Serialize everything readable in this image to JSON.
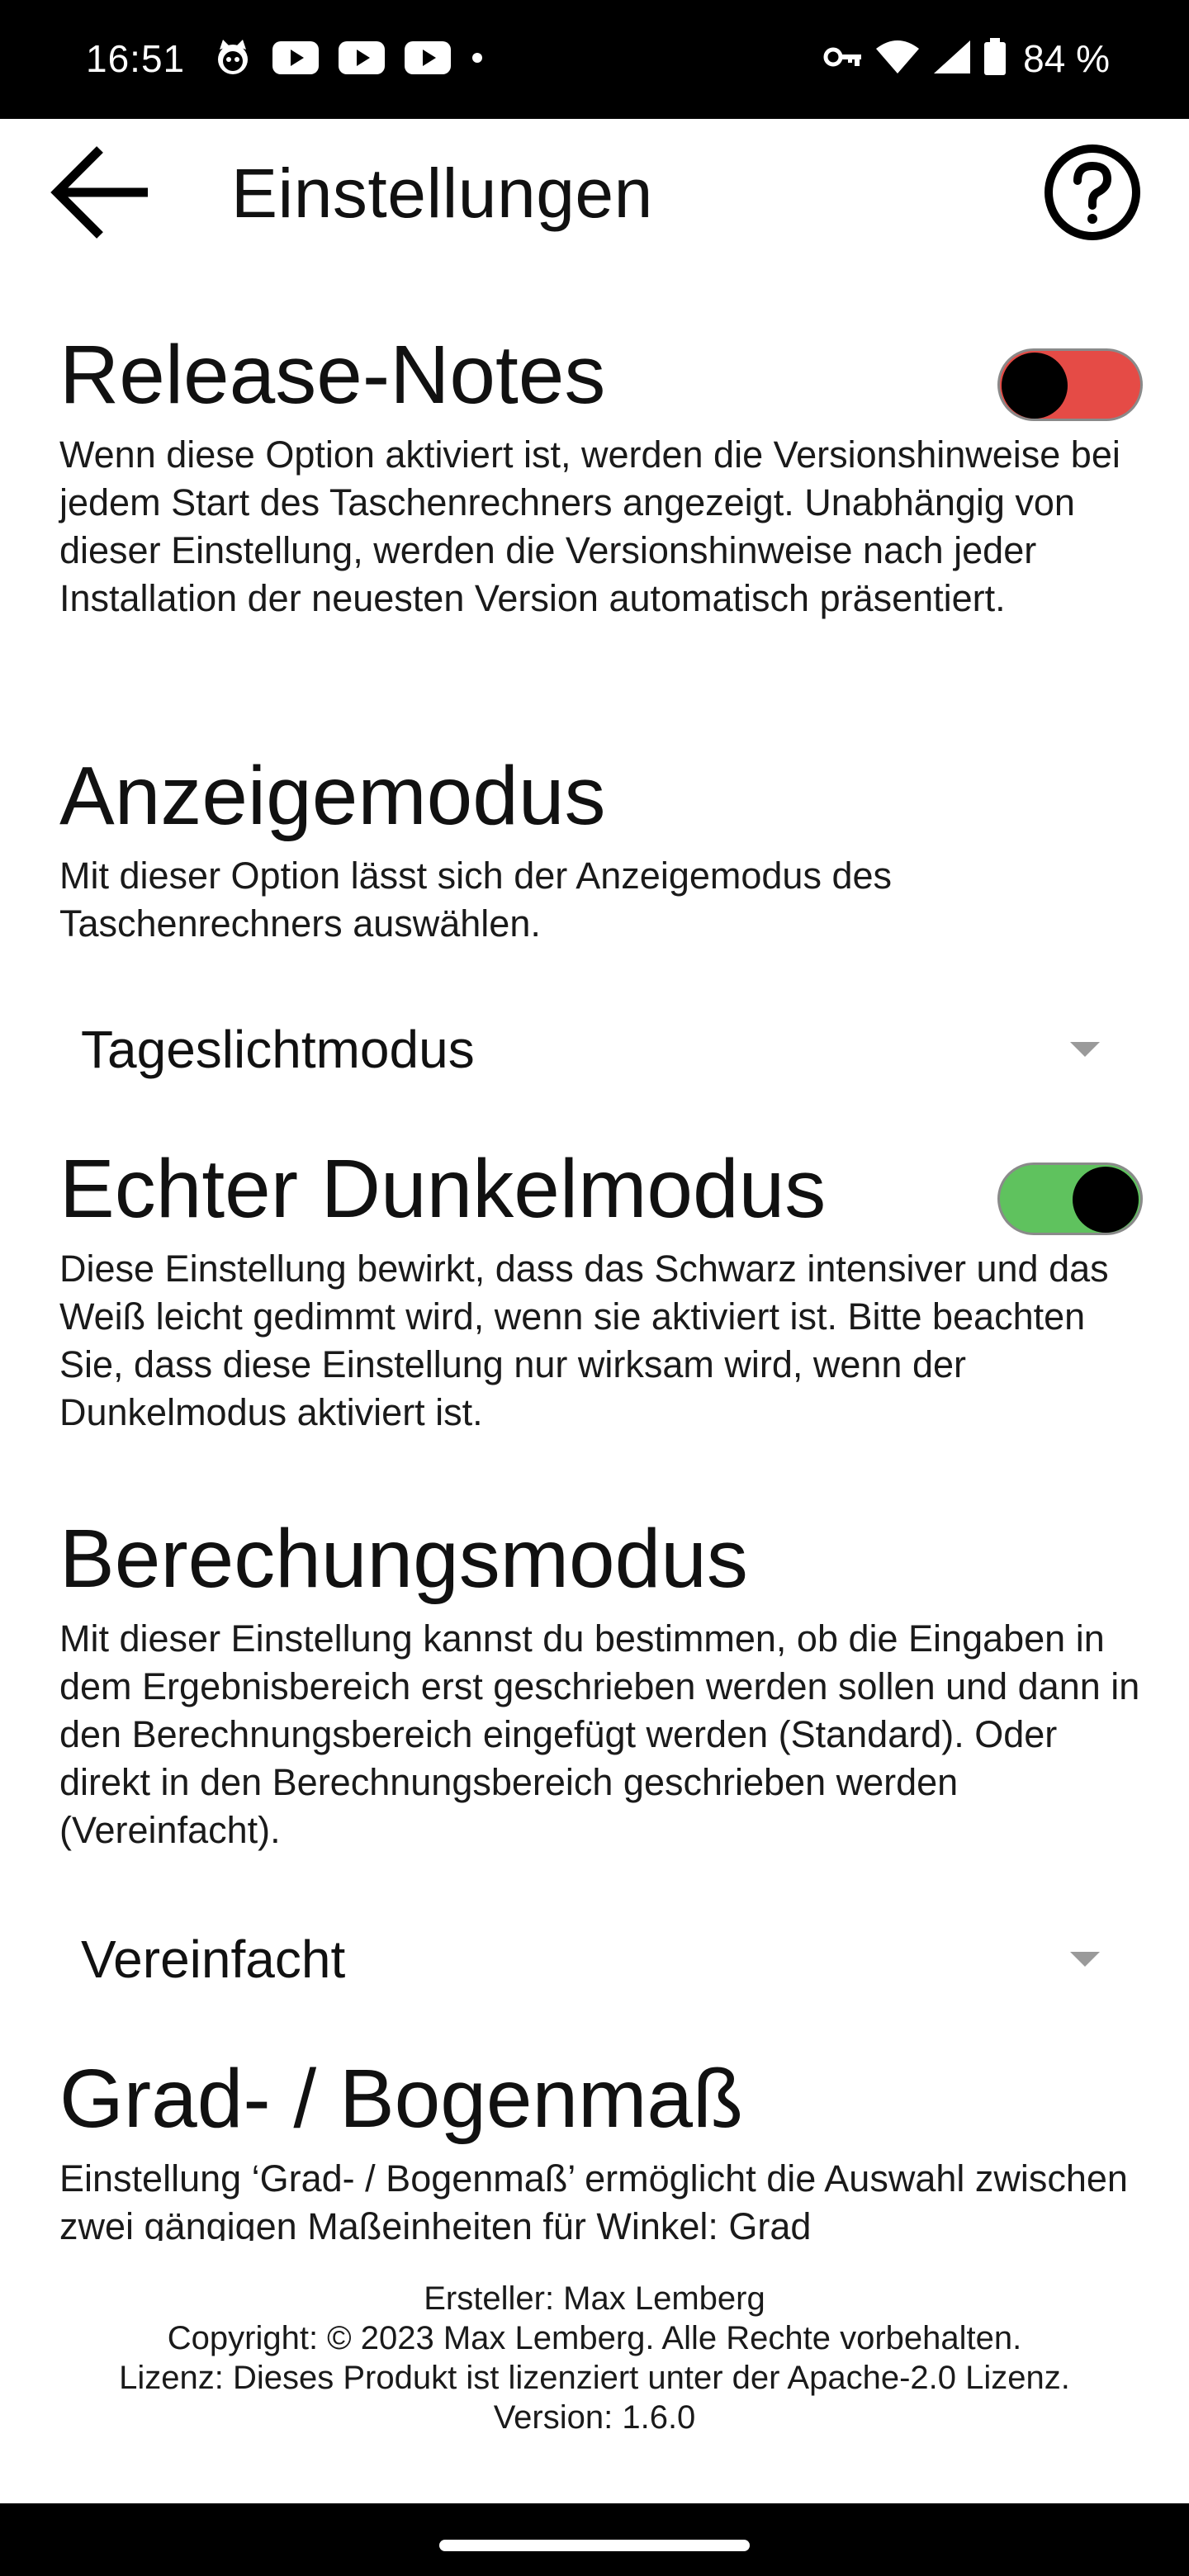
{
  "status_bar": {
    "time": "16:51",
    "left_icons": [
      "cat-face-icon",
      "youtube-icon",
      "youtube-icon",
      "youtube-icon",
      "dot-icon"
    ],
    "right_icons": [
      "vpn-key-icon",
      "wifi-icon",
      "signal-icon",
      "battery-icon"
    ],
    "battery": "84 %"
  },
  "app_bar": {
    "title": "Einstellungen",
    "back_icon": "arrow-back-icon",
    "help_icon": "help-circle-icon"
  },
  "sections": {
    "release_notes": {
      "title": "Release-Notes",
      "description": "Wenn diese Option aktiviert ist, werden die Versionshinweise bei jedem Start des Taschenrechners angezeigt. Unabhängig von dieser Einstellung, werden die Versionshinweise nach jeder Installation der neuesten Version automatisch präsentiert.",
      "toggle_state": "off",
      "toggle_color": "#e54b46"
    },
    "display_mode": {
      "title": "Anzeigemodus",
      "description": "Mit dieser Option lässt sich der Anzeigemodus des Taschenrechners auswählen.",
      "selected": "Tageslichtmodus"
    },
    "true_dark_mode": {
      "title": "Echter Dunkelmodus",
      "description": "Diese Einstellung bewirkt, dass das Schwarz intensiver und das Weiß leicht gedimmt wird, wenn sie aktiviert ist. Bitte beachten Sie, dass diese Einstellung nur wirksam wird, wenn der Dunkelmodus aktiviert ist.",
      "toggle_state": "on",
      "toggle_color": "#5fc25e"
    },
    "calculation_mode": {
      "title": "Berechungsmodus",
      "description": "Mit dieser Einstellung kannst du bestimmen, ob die Eingaben in dem Ergebnisbereich erst geschrieben werden sollen und dann in den Berechnungsbereich eingefügt werden (Standard). Oder direkt in den Berechnungsbereich geschrieben werden (Vereinfacht).",
      "selected": "Vereinfacht"
    },
    "degree_radian": {
      "title": "Grad- / Bogenmaß",
      "description": "Einstellung ‘Grad- / Bogenmaß’ ermöglicht die Auswahl zwischen zwei gängigen Maßeinheiten für Winkel: Grad"
    }
  },
  "footer": {
    "creator": "Ersteller: Max Lemberg",
    "copyright": "Copyright: © 2023 Max Lemberg. Alle Rechte vorbehalten.",
    "license": "Lizenz: Dieses Produkt ist lizenziert unter der Apache-2.0 Lizenz.",
    "version": "Version: 1.6.0"
  }
}
